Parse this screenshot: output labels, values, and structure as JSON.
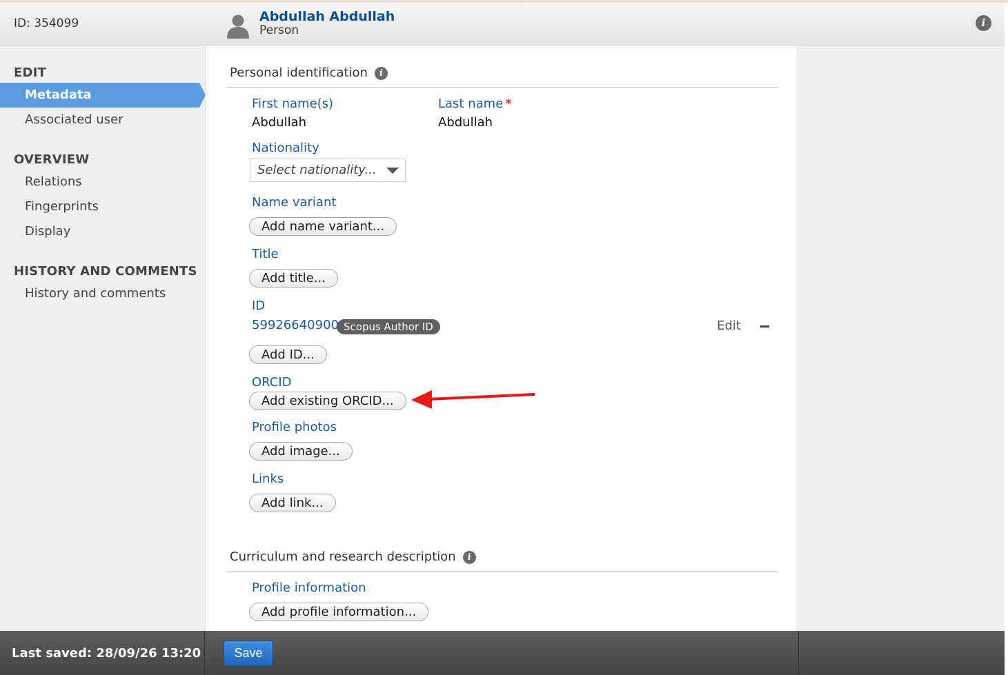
{
  "header": {
    "id_label": "ID: 354099",
    "person_name": "Abdullah Abdullah",
    "person_type": "Person",
    "info_icon": "info-icon",
    "avatar_icon": "person-silhouette-icon"
  },
  "sidebar": {
    "edit_heading": "EDIT",
    "edit_items": [
      "Metadata",
      "Associated user"
    ],
    "overview_heading": "OVERVIEW",
    "overview_items": [
      "Relations",
      "Fingerprints",
      "Display"
    ],
    "history_heading": "HISTORY AND COMMENTS",
    "history_items": [
      "History and comments"
    ],
    "active_color": "#5a9de0"
  },
  "personal": {
    "title": "Personal identification",
    "first_name_label": "First name(s)",
    "first_name_value": "Abdullah",
    "last_name_label": "Last name",
    "last_name_value": "Abdullah",
    "required_mark": "*",
    "nationality_label": "Nationality",
    "nationality_placeholder": "Select nationality...",
    "name_variant_label": "Name variant",
    "name_variant_button": "Add name variant...",
    "title_label": "Title",
    "title_button": "Add title...",
    "id_label": "ID",
    "id_value": "59926640900",
    "id_badge": "Scopus Author ID",
    "id_edit": "Edit",
    "id_button": "Add ID...",
    "orcid_label": "ORCID",
    "orcid_button": "Add existing ORCID...",
    "photos_label": "Profile photos",
    "photos_button": "Add image...",
    "links_label": "Links",
    "links_button": "Add link..."
  },
  "curriculum": {
    "title": "Curriculum and research description",
    "profile_label": "Profile information",
    "profile_button": "Add profile information..."
  },
  "footer": {
    "last_saved": "Last saved: 28/09/26 13:20",
    "save_label": "Save"
  },
  "annotation": {
    "arrow_color": "#e31b1b"
  }
}
